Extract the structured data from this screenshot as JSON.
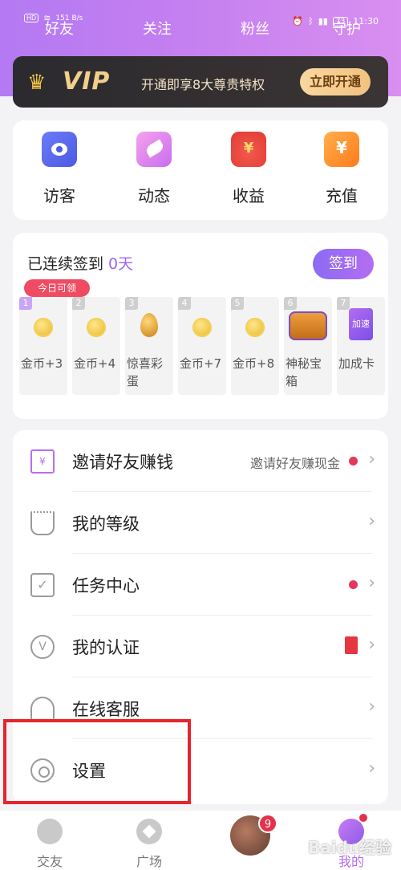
{
  "status_bar": {
    "left_hd": "HD",
    "left_speed": "151\nB/s",
    "right_battery": "73",
    "right_time": "11:30"
  },
  "top_tabs": [
    "好友",
    "关注",
    "粉丝",
    "守护"
  ],
  "vip": {
    "logo": "VIP",
    "description": "开通即享8大尊贵特权",
    "button": "立即开通"
  },
  "shortcuts": [
    {
      "label": "访客",
      "icon": "visitor-icon"
    },
    {
      "label": "动态",
      "icon": "moment-icon"
    },
    {
      "label": "收益",
      "icon": "income-icon"
    },
    {
      "label": "充值",
      "icon": "recharge-icon"
    }
  ],
  "signin": {
    "title_prefix": "已连续签到 ",
    "days": "0天",
    "button": "签到",
    "today_tag": "今日可领",
    "days_list": [
      {
        "num": "1",
        "label": "金币+3"
      },
      {
        "num": "2",
        "label": "金币+4"
      },
      {
        "num": "3",
        "label": "惊喜彩蛋"
      },
      {
        "num": "4",
        "label": "金币+7"
      },
      {
        "num": "5",
        "label": "金币+8"
      },
      {
        "num": "6",
        "label": "神秘宝箱"
      },
      {
        "num": "7",
        "label": "加成卡"
      }
    ],
    "speed_card_text": "加速"
  },
  "menu": [
    {
      "label": "邀请好友赚钱",
      "right_text": "邀请好友赚现金"
    },
    {
      "label": "我的等级",
      "right_text": ""
    },
    {
      "label": "任务中心",
      "right_text": ""
    },
    {
      "label": "我的认证",
      "right_text": ""
    },
    {
      "label": "在线客服",
      "right_text": ""
    },
    {
      "label": "设置",
      "right_text": ""
    }
  ],
  "bottom_nav": [
    {
      "label": "交友"
    },
    {
      "label": "广场"
    },
    {
      "label": ""
    },
    {
      "label": "我的"
    }
  ],
  "nav_badge": "9",
  "watermark": "Baidu经验"
}
